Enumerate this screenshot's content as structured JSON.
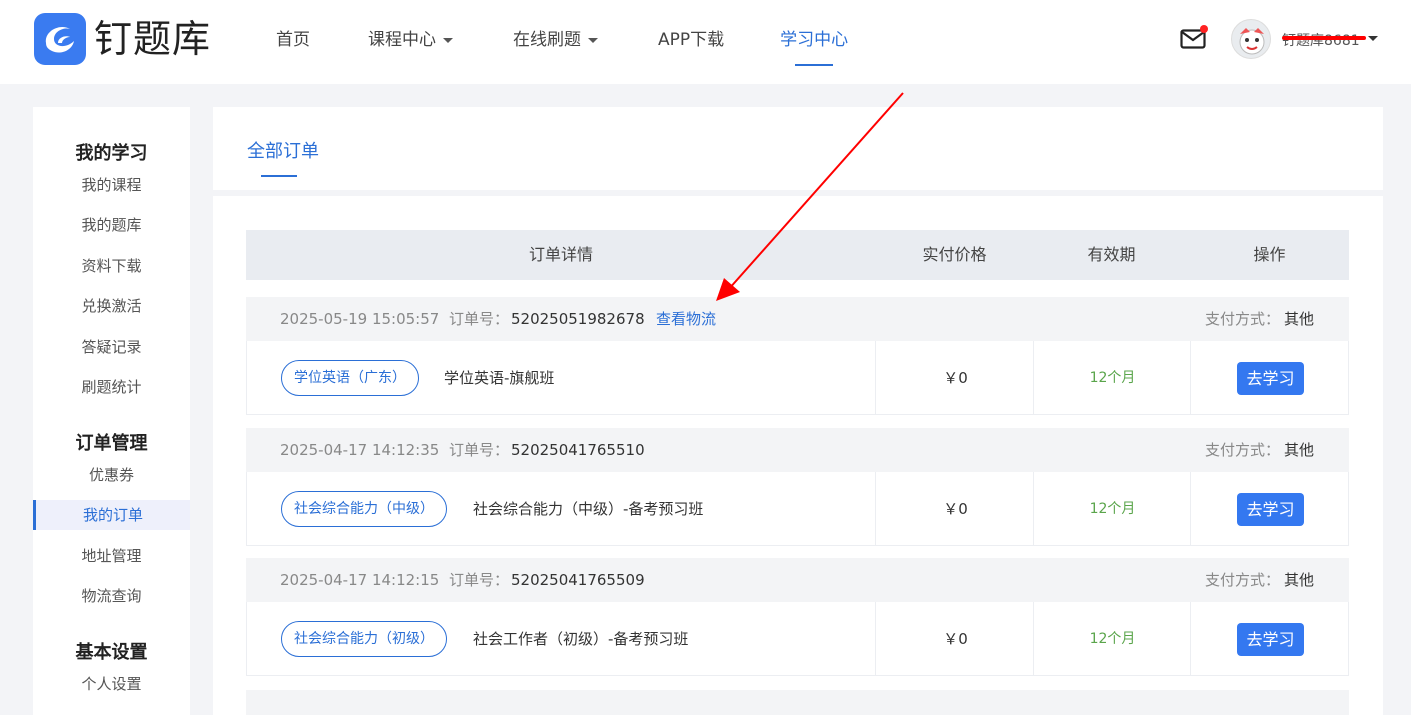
{
  "header": {
    "logo_text": "钉题库",
    "nav": [
      {
        "label": "首页",
        "has_caret": false,
        "active": false
      },
      {
        "label": "课程中心",
        "has_caret": true,
        "active": false
      },
      {
        "label": "在线刷题",
        "has_caret": true,
        "active": false
      },
      {
        "label": "APP下载",
        "has_caret": false,
        "active": false
      },
      {
        "label": "学习中心",
        "has_caret": false,
        "active": true
      }
    ],
    "username": "钉题库8681",
    "has_unread_mail": true
  },
  "sidebar": {
    "sections": [
      {
        "heading": "我的学习",
        "items": [
          "我的课程",
          "我的题库",
          "资料下载",
          "兑换激活",
          "答疑记录",
          "刷题统计"
        ]
      },
      {
        "heading": "订单管理",
        "items": [
          "优惠券",
          "我的订单",
          "地址管理",
          "物流查询"
        ]
      },
      {
        "heading": "基本设置",
        "items": [
          "个人设置"
        ]
      }
    ],
    "active_item": "我的订单"
  },
  "tabs": {
    "active": "全部订单"
  },
  "table": {
    "headers": [
      "订单详情",
      "实付价格",
      "有效期",
      "操作"
    ]
  },
  "orders": [
    {
      "time": "2025-05-19 15:05:57",
      "order_label": "订单号：",
      "order_no": "52025051982678",
      "logistics_link": "查看物流",
      "pay_label": "支付方式：",
      "pay_method": "其他",
      "tag": "学位英语（广东）",
      "course": "学位英语-旗舰班",
      "price": "￥0",
      "validity": "12个月",
      "action": "去学习"
    },
    {
      "time": "2025-04-17 14:12:35",
      "order_label": "订单号：",
      "order_no": "52025041765510",
      "logistics_link": "",
      "pay_label": "支付方式：",
      "pay_method": "其他",
      "tag": "社会综合能力（中级）",
      "course": "社会综合能力（中级）-备考预习班",
      "price": "￥0",
      "validity": "12个月",
      "action": "去学习"
    },
    {
      "time": "2025-04-17 14:12:15",
      "order_label": "订单号：",
      "order_no": "52025041765509",
      "logistics_link": "",
      "pay_label": "支付方式：",
      "pay_method": "其他",
      "tag": "社会综合能力（初级）",
      "course": "社会工作者（初级）-备考预习班",
      "price": "￥0",
      "validity": "12个月",
      "action": "去学习"
    }
  ],
  "colors": {
    "accent": "#2b6fd6",
    "button": "#3478f0",
    "validity": "#5aa54b",
    "annotation_arrow": "#ff0000"
  },
  "icons": [
    "logo-icon",
    "mail-icon",
    "avatar-icon",
    "chevron-down-icon",
    "annotation-arrow"
  ]
}
